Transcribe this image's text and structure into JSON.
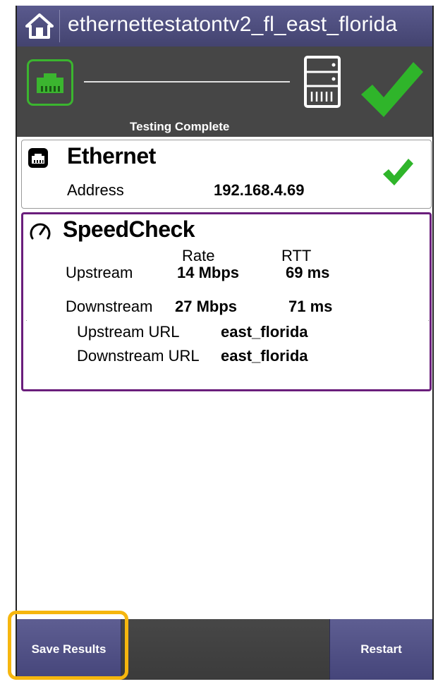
{
  "titlebar": {
    "title": "ethernettestatontv2_fl_east_florida",
    "home_icon": "home-icon"
  },
  "status_panel": {
    "status_text": "Testing Complete",
    "ethernet_icon": "ethernet-port-icon",
    "server_icon": "server-icon",
    "result_icon": "checkmark-icon",
    "accent_green": "#3bb52f"
  },
  "ethernet": {
    "title": "Ethernet",
    "address_label": "Address",
    "address_value": "192.168.4.69"
  },
  "speedcheck": {
    "title": "SpeedCheck",
    "col_rate": "Rate",
    "col_rtt": "RTT",
    "rows": [
      {
        "label": "Upstream",
        "rate": "14 Mbps",
        "rtt": "69 ms"
      },
      {
        "label": "Downstream",
        "rate": "27 Mbps",
        "rtt": "71 ms"
      }
    ],
    "upstream_url_label": "Upstream URL",
    "upstream_url_value": "east_florida",
    "downstream_url_label": "Downstream URL",
    "downstream_url_value": "east_florida",
    "border_color": "#6a1e7c"
  },
  "bottom": {
    "save_label": "Save Results",
    "restart_label": "Restart",
    "highlight_color": "#f6b60e"
  }
}
